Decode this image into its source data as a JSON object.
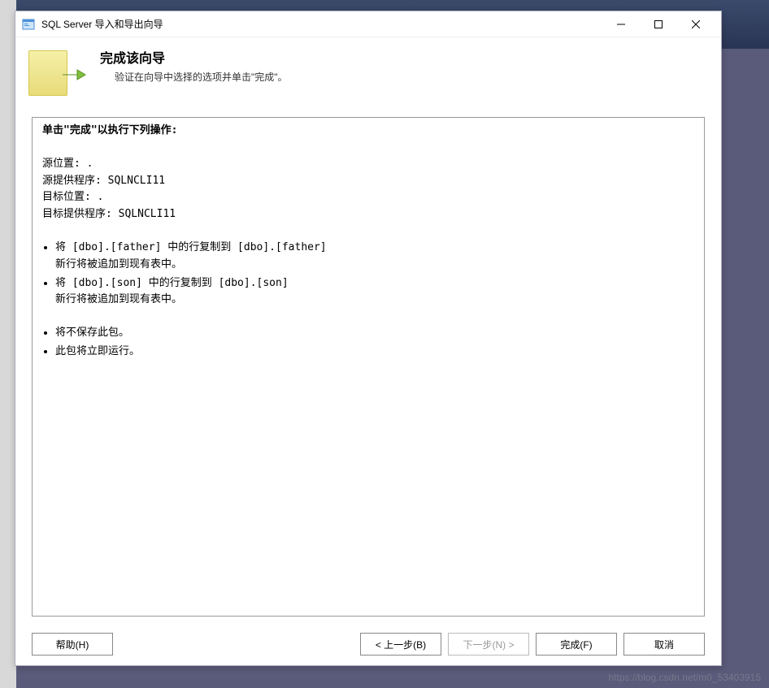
{
  "window": {
    "title": "SQL Server 导入和导出向导"
  },
  "header": {
    "title": "完成该向导",
    "subtitle": "验证在向导中选择的选项并单击\"完成\"。"
  },
  "content": {
    "heading": "单击\"完成\"以执行下列操作:",
    "source_location_label": "源位置: .",
    "source_provider_label": "源提供程序: SQLNCLI11",
    "dest_location_label": "目标位置: .",
    "dest_provider_label": "目标提供程序: SQLNCLI11",
    "copy_actions": [
      {
        "main": "将 [dbo].[father] 中的行复制到 [dbo].[father]",
        "sub": "新行将被追加到现有表中。"
      },
      {
        "main": "将 [dbo].[son] 中的行复制到 [dbo].[son]",
        "sub": "新行将被追加到现有表中。"
      }
    ],
    "package_actions": [
      "将不保存此包。",
      "此包将立即运行。"
    ]
  },
  "footer": {
    "help": "帮助(H)",
    "back": "< 上一步(B)",
    "next": "下一步(N) >",
    "finish": "完成(F)",
    "cancel": "取消"
  },
  "watermark": "https://blog.csdn.net/m0_53403915"
}
